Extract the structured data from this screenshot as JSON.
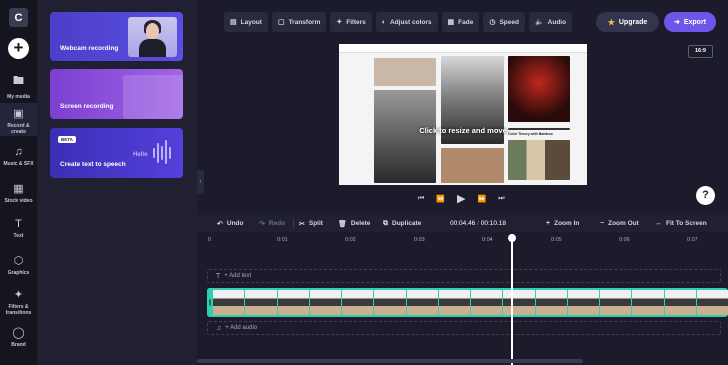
{
  "app": {
    "logo_letter": "C"
  },
  "rail": {
    "create_symbol": "+",
    "items": [
      {
        "label": "My media",
        "icon": "folder-icon"
      },
      {
        "label": "Record & create",
        "icon": "camera-icon"
      },
      {
        "label": "Music & SFX",
        "icon": "music-icon"
      },
      {
        "label": "Stock video",
        "icon": "film-icon"
      },
      {
        "label": "Text",
        "icon": "text-icon"
      },
      {
        "label": "Graphics",
        "icon": "shapes-icon"
      },
      {
        "label": "Filters & transitions",
        "icon": "filters-icon"
      },
      {
        "label": "Brand",
        "icon": "shield-icon"
      }
    ]
  },
  "panel": {
    "cards": [
      {
        "label": "Webcam recording"
      },
      {
        "label": "Screen recording"
      },
      {
        "label": "Create text to speech",
        "badge": "BETA",
        "wave_text": "Hello"
      }
    ]
  },
  "toolbar": {
    "items": [
      {
        "label": "Layout",
        "icon": "layout-icon"
      },
      {
        "label": "Transform",
        "icon": "transform-icon"
      },
      {
        "label": "Filters",
        "icon": "sparkle-icon"
      },
      {
        "label": "Adjust colors",
        "icon": "color-icon"
      },
      {
        "label": "Fade",
        "icon": "fade-icon"
      },
      {
        "label": "Speed",
        "icon": "speed-icon"
      },
      {
        "label": "Audio",
        "icon": "audio-icon"
      }
    ],
    "upgrade_label": "Upgrade",
    "export_label": "Export"
  },
  "preview": {
    "aspect_ratio": "16:9",
    "overlay_text": "Click to resize and move",
    "page_heading": "Color Theory with Bamboo"
  },
  "playback": {
    "current_time": "00:04.46",
    "separator": " / ",
    "total_time": "00:10.18"
  },
  "timeline": {
    "undo_label": "Undo",
    "redo_label": "Redo",
    "split_label": "Split",
    "delete_label": "Delete",
    "duplicate_label": "Duplicate",
    "zoom_in_label": "Zoom In",
    "zoom_out_label": "Zoom Out",
    "fit_label": "Fit To Screen",
    "ticks": [
      "0",
      "0:01",
      "0:02",
      "0:03",
      "0:04",
      "0:05",
      "0:06",
      "0:07"
    ],
    "add_text_label": "+ Add text",
    "add_audio_label": "+ Add audio",
    "playhead_seconds": 4.46
  },
  "help_label": "?",
  "colors": {
    "accent": "#6e56e8",
    "clip": "#2fd0b0",
    "background": "#1b1b2c"
  }
}
